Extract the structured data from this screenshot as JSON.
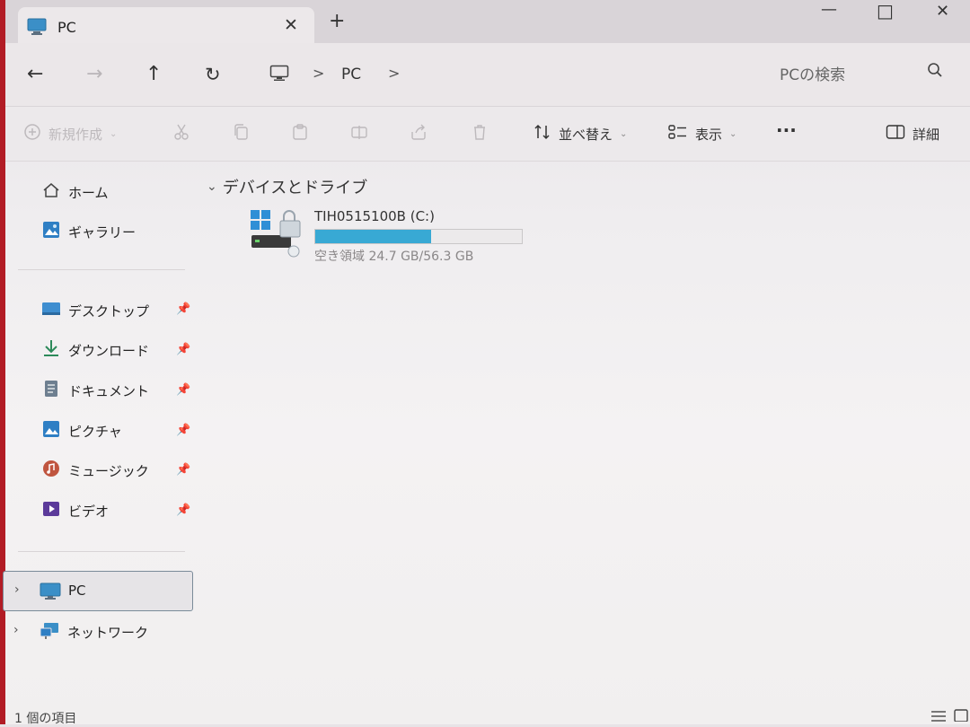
{
  "window": {
    "tab_title": "PC",
    "tab_close": "✕",
    "new_tab": "+",
    "minimize": "—",
    "maximize": "□",
    "close": "✕"
  },
  "nav": {
    "back": "←",
    "forward": "→",
    "up": "↑",
    "refresh": "↻",
    "breadcrumb": [
      "PC"
    ],
    "crumb_sep": ">",
    "search_placeholder": "PCの検索"
  },
  "toolbar": {
    "new_label": "新規作成",
    "sort_label": "並べ替え",
    "view_label": "表示",
    "more": "···",
    "details_label": "詳細"
  },
  "sidebar": {
    "home": "ホーム",
    "gallery": "ギャラリー",
    "quick": [
      {
        "label": "デスクトップ",
        "icon": "desktop-icon"
      },
      {
        "label": "ダウンロード",
        "icon": "download-icon"
      },
      {
        "label": "ドキュメント",
        "icon": "document-icon"
      },
      {
        "label": "ピクチャ",
        "icon": "pictures-icon"
      },
      {
        "label": "ミュージック",
        "icon": "music-icon"
      },
      {
        "label": "ビデオ",
        "icon": "video-icon"
      }
    ],
    "pc": "PC",
    "network": "ネットワーク"
  },
  "main": {
    "group_title": "デバイスとドライブ",
    "drive": {
      "name": "TIH0515100B (C:)",
      "free_text": "空き領域 24.7 GB/56.3 GB",
      "used_fraction": 0.56
    }
  },
  "status_bar": {
    "item_count": "1 個の項目"
  },
  "colors": {
    "accent": "#38a9d4",
    "window_bg": "#f1efef"
  }
}
